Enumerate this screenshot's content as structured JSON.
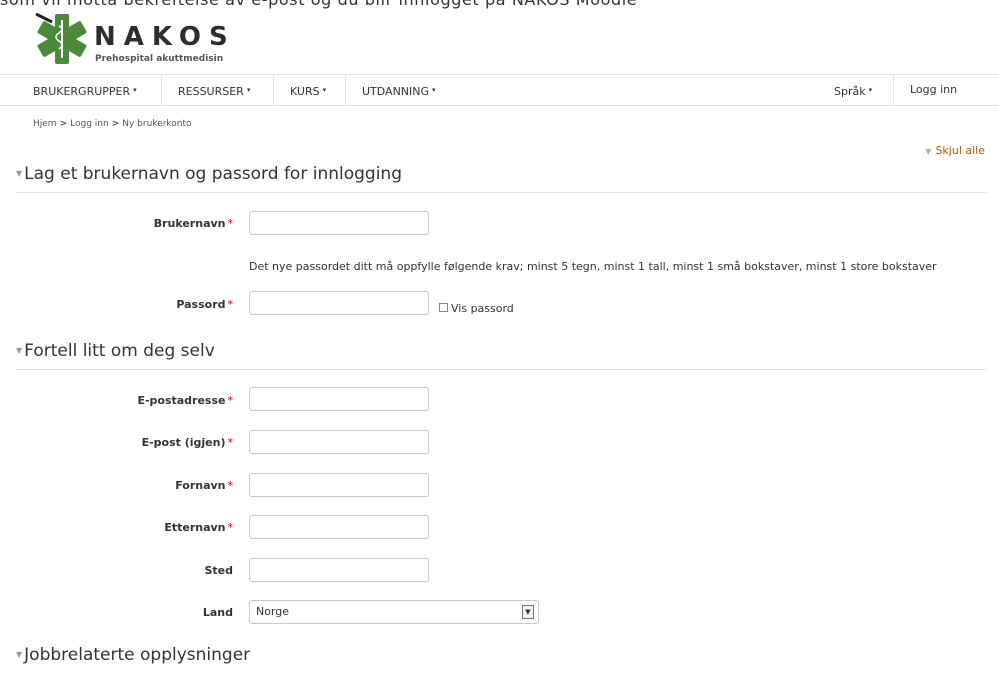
{
  "top_clipped_text": "som vil motta bekreftelse av e-post og du blir innlogget på NAKOS Moodle",
  "logo": {
    "name": "NAKOS",
    "tagline": "Prehospital akuttmedisin"
  },
  "nav": {
    "items": [
      "BRUKERGRUPPER",
      "RESSURSER",
      "KURS",
      "UTDANNING"
    ],
    "language": "Språk",
    "login": "Logg inn"
  },
  "breadcrumb": [
    "Hjem",
    "Logg inn",
    "Ny brukerkonto"
  ],
  "collapse_all": "Skjul alle",
  "sections": [
    {
      "title": "Lag et brukernavn og passord for innlogging"
    },
    {
      "title": "Fortell litt om deg selv"
    },
    {
      "title": "Jobbrelaterte opplysninger"
    }
  ],
  "fields": {
    "username": "Brukernavn",
    "password_hint": "Det nye passordet ditt må oppfylle følgende krav; minst 5 tegn, minst 1 tall, minst 1 små bokstaver, minst 1 store bokstaver",
    "password": "Passord",
    "show_password": "Vis passord",
    "email": "E-postadresse",
    "email_again": "E-post (igjen)",
    "firstname": "Fornavn",
    "lastname": "Etternavn",
    "city": "Sted",
    "country": "Land",
    "country_value": "Norge"
  },
  "required_marker": "*",
  "colors": {
    "accent_link": "#b15b00",
    "required": "#cc0000",
    "logo_green": "#4a8a3a"
  }
}
